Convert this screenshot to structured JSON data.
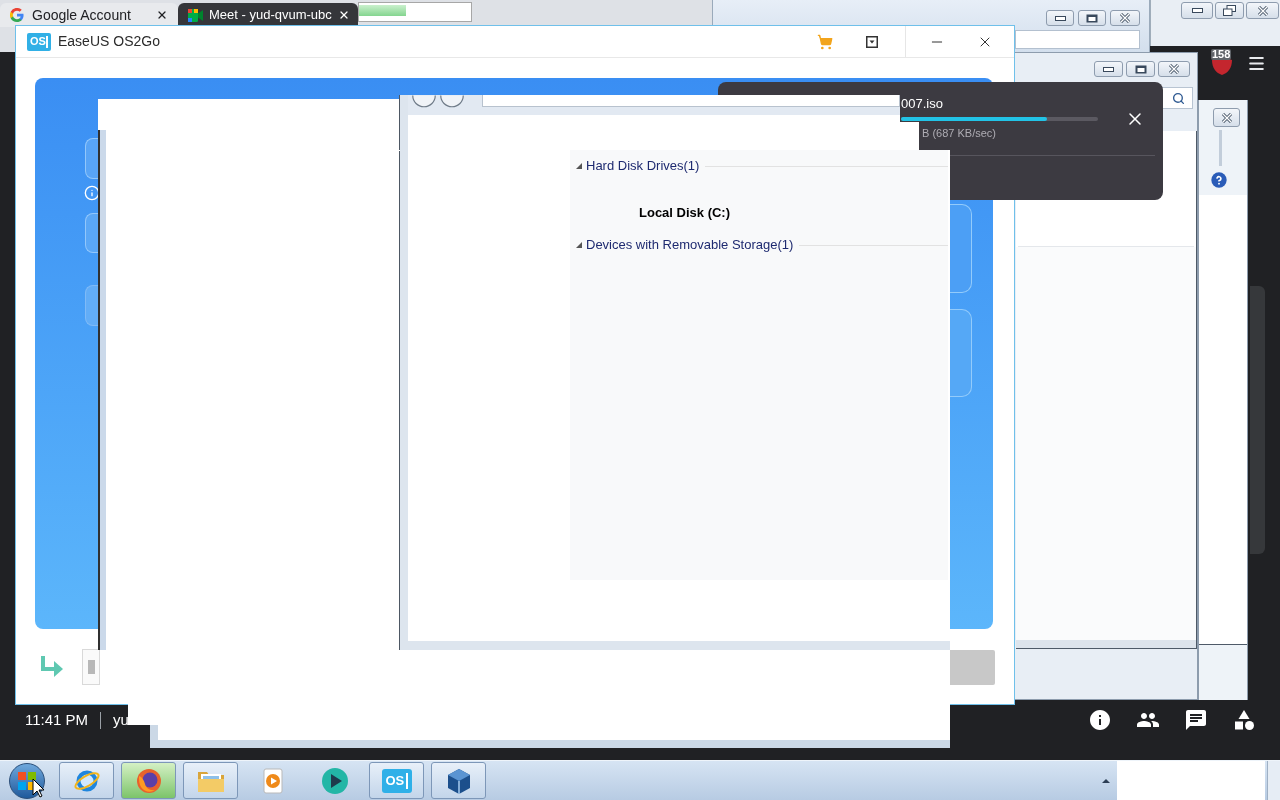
{
  "browser": {
    "tabs": [
      {
        "label": "Google Account",
        "selected": false
      },
      {
        "label": "Meet - yud-qvum-ubc",
        "selected": true
      }
    ]
  },
  "extension_badge": {
    "count": "158"
  },
  "app_window": {
    "logo": "OS",
    "title": "EaseUS OS2Go"
  },
  "download": {
    "file": "007.iso",
    "level": 0.74,
    "status": "B (687 KB/sec)"
  },
  "explorer": {
    "groups": [
      {
        "label": "Hard Disk Drives(1)",
        "expanded": true,
        "items": [
          {
            "label": "Local Disk (C:)"
          }
        ]
      },
      {
        "label": "Devices with Removable Storage(1)",
        "expanded": true
      }
    ]
  },
  "meeting_bar": {
    "time": "11:41 PM",
    "label": "yu"
  },
  "taskbar": {
    "apps": [
      {
        "kind": "web",
        "running": true,
        "selected": false
      },
      {
        "kind": "fox",
        "running": true,
        "selected": true
      },
      {
        "kind": "folder",
        "running": true,
        "selected": false
      },
      {
        "kind": "media",
        "running": false,
        "selected": false
      },
      {
        "kind": "player",
        "running": false,
        "selected": false
      },
      {
        "kind": "logo",
        "label": "OS",
        "running": true,
        "selected": false
      },
      {
        "kind": "cube",
        "running": true,
        "selected": false
      }
    ]
  }
}
